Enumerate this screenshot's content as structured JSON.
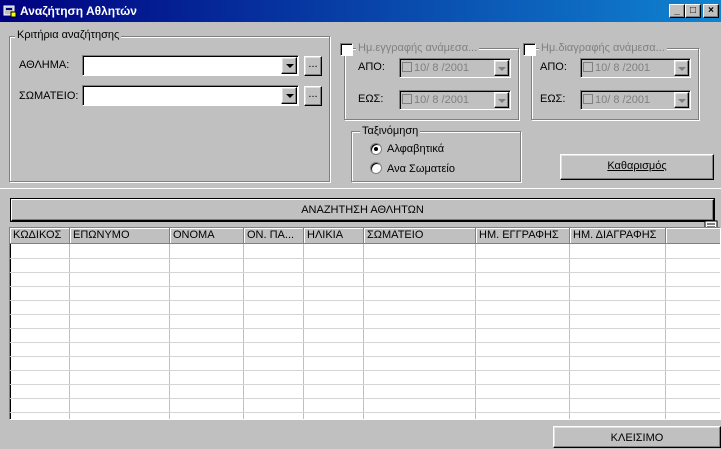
{
  "window": {
    "title": "Αναζήτηση Αθλητών",
    "min": "_",
    "max": "□",
    "close": "×"
  },
  "criteria": {
    "group_title": "Κριτήρια αναζήτησης",
    "sport_label": "ΑΘΛΗΜΑ:",
    "sport_value": "",
    "club_label": "ΣΩΜΑΤΕΙΟ:",
    "club_value": "",
    "ellipsis": "..."
  },
  "registration": {
    "title": "Ημ.εγγραφής ανάμεσα...",
    "from_label": "ΑΠΟ:",
    "from_value": "10/ 8 /2001",
    "to_label": "ΕΩΣ:",
    "to_value": "10/ 8 /2001"
  },
  "deletion": {
    "title": "Ημ.διαγραφής ανάμεσα...",
    "from_label": "ΑΠΟ:",
    "from_value": "10/ 8 /2001",
    "to_label": "ΕΩΣ:",
    "to_value": "10/ 8 /2001"
  },
  "sorting": {
    "title": "Ταξινόμηση",
    "option_alpha": "Αλφαβητικά",
    "option_club": "Ανα Σωματείο",
    "selected": "Αλφαβητικά"
  },
  "buttons": {
    "clear": "Καθαρισμός",
    "search": "ΑΝΑΖΗΤΗΣΗ ΑΘΛΗΤΩΝ",
    "close": "ΚΛΕΙΣΙΜΟ"
  },
  "table": {
    "columns": [
      "ΚΩΔΙΚΟΣ",
      "ΕΠΩΝΥΜΟ",
      "ΟΝΟΜΑ",
      "ΟΝ. ΠΑ...",
      "ΗΛΙΚΙΑ",
      "ΣΩΜΑΤΕΙΟ",
      "ΗΜ. ΕΓΓΡΑΦΗΣ",
      "ΗΜ. ΔΙΑΓΡΑΦΗΣ"
    ],
    "rows": []
  },
  "colors": {
    "titlebar": "#000080",
    "face": "#c0c0c0",
    "grid_bg": "#ffffff"
  }
}
